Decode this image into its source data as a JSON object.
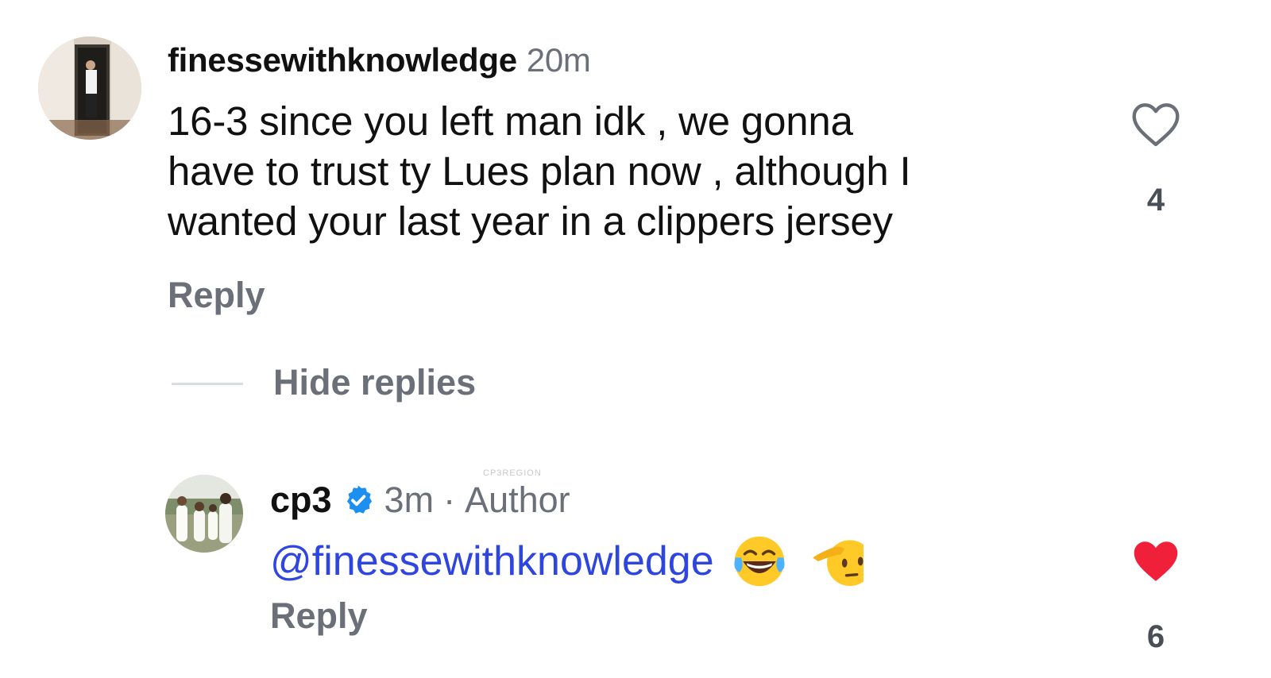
{
  "comment": {
    "username": "finessewithknowledge",
    "time": "20m",
    "text_lines": [
      "16-3 since you left man idk , we gonna",
      "have to trust ty Lues plan now , although I",
      "wanted your last year in a clippers jersey"
    ],
    "reply_label": "Reply",
    "like_count": "4",
    "liked": false
  },
  "replies_toggle": "Hide replies",
  "reply": {
    "username": "cp3",
    "verified": true,
    "time": "3m",
    "separator": "·",
    "role": "Author",
    "mention": "@finessewithknowledge",
    "emojis": [
      "face-with-tears-of-joy",
      "saluting-face"
    ],
    "reply_label": "Reply",
    "like_count": "6",
    "liked": true
  },
  "watermark": "CP3REGION",
  "colors": {
    "mention": "#2f45e0",
    "liked_heart": "#f0203a",
    "verified": "#1d8ff0",
    "secondary_text": "#6b7078"
  }
}
